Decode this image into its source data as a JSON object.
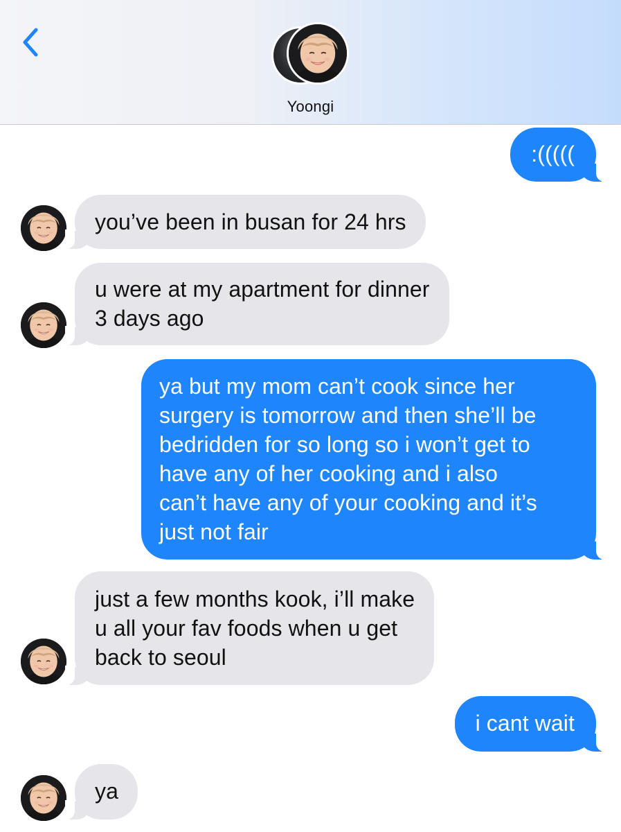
{
  "header": {
    "contact_name": "Yoongi",
    "back_icon": "chevron-left-icon",
    "accent_color": "#1f85fb"
  },
  "messages": [
    {
      "sender": "me",
      "text": ":((((("
    },
    {
      "sender": "them",
      "text": "you’ve been in busan for 24 hrs"
    },
    {
      "sender": "them",
      "text": "u were at my apartment for dinner\n3 days ago"
    },
    {
      "sender": "me",
      "text": "ya but my mom can’t cook since her\nsurgery is tomorrow and then she’ll be\nbedridden for so long so i won’t get to\nhave any of her cooking and i also\ncan’t have any of your cooking and it’s\njust not fair"
    },
    {
      "sender": "them",
      "text": "just a few months kook, i’ll make\nu all your fav foods when u get\nback to seoul"
    },
    {
      "sender": "me",
      "text": "i cant wait"
    },
    {
      "sender": "them",
      "text": "ya"
    }
  ],
  "colors": {
    "outgoing_bubble": "#1f85fb",
    "incoming_bubble": "#e5e5ea"
  }
}
